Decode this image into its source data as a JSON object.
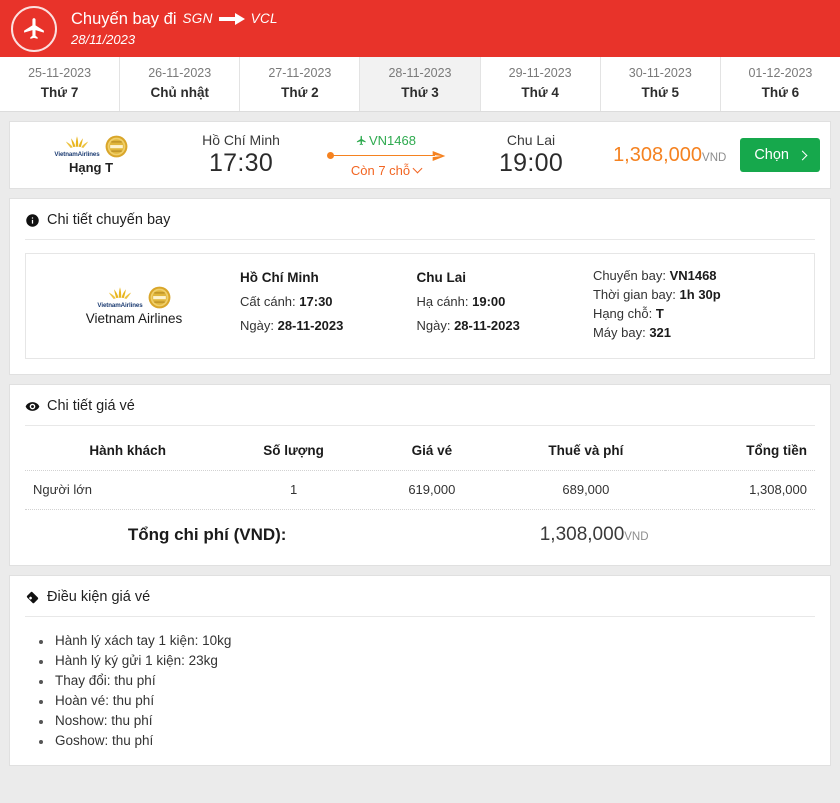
{
  "header": {
    "title": "Chuyến bay đi",
    "origin_code": "SGN",
    "dest_code": "VCL",
    "date": "28/11/2023",
    "plane_icon": "airplane-icon",
    "arrow_icon": "arrow-right-icon",
    "brand_color": "#e8332a"
  },
  "date_tabs": [
    {
      "date": "25-11-2023",
      "day": "Thứ 7",
      "active": false
    },
    {
      "date": "26-11-2023",
      "day": "Chủ nhật",
      "active": false
    },
    {
      "date": "27-11-2023",
      "day": "Thứ 2",
      "active": false
    },
    {
      "date": "28-11-2023",
      "day": "Thứ 3",
      "active": true
    },
    {
      "date": "29-11-2023",
      "day": "Thứ 4",
      "active": false
    },
    {
      "date": "30-11-2023",
      "day": "Thứ 5",
      "active": false
    },
    {
      "date": "01-12-2023",
      "day": "Thứ 6",
      "active": false
    }
  ],
  "flight_row": {
    "airline_word": "VietnamAirlines",
    "airline_logo_icon": "vietnam-airlines-lotus-icon",
    "award_badge_icon": "gold-award-badge-icon",
    "cabin_class": "Hạng T",
    "departure_city": "Hồ Chí Minh",
    "departure_time": "17:30",
    "flight_number": "VN1468",
    "flight_icon": "airplane-small-icon",
    "route_end_icon": "airplane-arrow-icon",
    "seats_left": "Còn 7 chỗ",
    "seats_chevron_icon": "chevron-down-icon",
    "arrival_city": "Chu Lai",
    "arrival_time": "19:00",
    "price": "1,308,000",
    "currency": "VND",
    "choose_label": "Chọn",
    "choose_chevron_icon": "chevron-right-icon",
    "price_color": "#f58220",
    "button_color": "#16a84c",
    "flight_no_color": "#2eaa4f"
  },
  "flight_detail": {
    "section_title": "Chi tiết chuyến bay",
    "section_icon": "info-circle-icon",
    "airline_name": "Vietnam Airlines",
    "departure": {
      "city": "Hồ Chí Minh",
      "time_label": "Cất cánh:",
      "time": "17:30",
      "date_label": "Ngày:",
      "date": "28-11-2023"
    },
    "arrival": {
      "city": "Chu Lai",
      "time_label": "Hạ cánh:",
      "time": "19:00",
      "date_label": "Ngày:",
      "date": "28-11-2023"
    },
    "info": {
      "flight_label": "Chuyến bay:",
      "flight_value": "VN1468",
      "duration_label": "Thời gian bay:",
      "duration_value": "1h 30p",
      "class_label": "Hạng chỗ:",
      "class_value": "T",
      "aircraft_label": "Máy bay:",
      "aircraft_value": "321"
    }
  },
  "price_detail": {
    "section_title": "Chi tiết giá vé",
    "section_icon": "eye-icon",
    "columns": [
      "Hành khách",
      "Số lượng",
      "Giá vé",
      "Thuế và phí",
      "Tổng tiền"
    ],
    "rows": [
      {
        "passenger": "Người lớn",
        "quantity": "1",
        "fare": "619,000",
        "tax": "689,000",
        "total": "1,308,000"
      }
    ],
    "total_label": "Tổng chi phí (VND):",
    "total_value": "1,308,000",
    "total_currency": "VND"
  },
  "fare_conditions": {
    "section_title": "Điều kiện giá vé",
    "section_icon": "ticket-tag-icon",
    "items": [
      "Hành lý xách tay 1 kiện: 10kg",
      "Hành lý ký gửi 1 kiện: 23kg",
      "Thay đổi: thu phí",
      "Hoàn vé: thu phí",
      "Noshow: thu phí",
      "Goshow: thu phí"
    ]
  }
}
